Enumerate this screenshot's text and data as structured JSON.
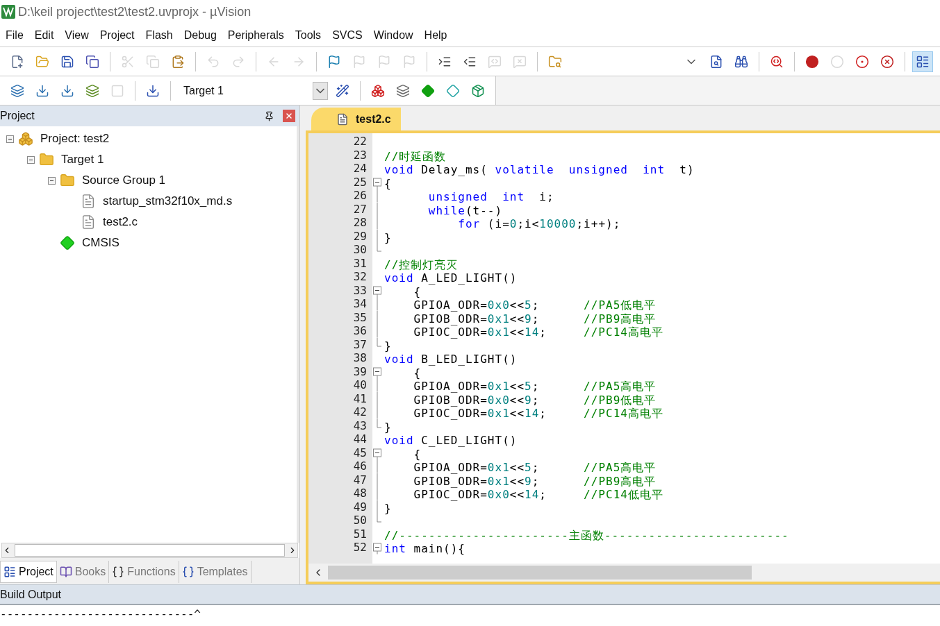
{
  "window": {
    "title": "D:\\keil project\\test2\\test2.uvprojx - µVision"
  },
  "menu": [
    "File",
    "Edit",
    "View",
    "Project",
    "Flash",
    "Debug",
    "Peripherals",
    "Tools",
    "SVCS",
    "Window",
    "Help"
  ],
  "toolbar_1": [
    {
      "disabled": false
    },
    {
      "disabled": false
    },
    {
      "disabled": false
    },
    {
      "disabled": false
    },
    {
      "disabled": true
    },
    {
      "disabled": true
    },
    {
      "disabled": false
    },
    {
      "disabled": true
    },
    {
      "disabled": true
    },
    {
      "disabled": true
    },
    {
      "disabled": true
    },
    {
      "disabled": false
    },
    {
      "disabled": true
    },
    {
      "disabled": true
    },
    {
      "disabled": true
    },
    {
      "disabled": false
    },
    {
      "disabled": false
    },
    {
      "disabled": true
    },
    {
      "disabled": true
    },
    {
      "disabled": false
    },
    {
      "disabled": false
    },
    {
      "disabled": false
    },
    {
      "disabled": false
    },
    {
      "disabled": false
    },
    {
      "disabled": false
    },
    {
      "disabled": true
    },
    {
      "disabled": false
    },
    {
      "disabled": false
    },
    {
      "disabled": false,
      "selected": true
    }
  ],
  "toolbar_2": {
    "buttons": [
      {
        "disabled": false
      },
      {
        "disabled": false
      },
      {
        "disabled": false
      },
      {
        "disabled": false
      },
      {
        "disabled": true
      },
      {
        "disabled": false
      },
      {
        "disabled": false
      },
      {
        "disabled": false
      },
      {
        "disabled": false
      },
      {
        "disabled": false
      },
      {
        "disabled": false
      },
      {
        "disabled": false
      }
    ],
    "target": "Target 1"
  },
  "project_panel": {
    "title": "Project",
    "tree": [
      {
        "label": "Project: test2",
        "kind": "project",
        "expanded": true,
        "children": [
          {
            "label": "Target 1",
            "kind": "target",
            "expanded": true,
            "children": [
              {
                "label": "Source Group 1",
                "kind": "group",
                "expanded": true,
                "children": [
                  {
                    "label": "startup_stm32f10x_md.s",
                    "kind": "file"
                  },
                  {
                    "label": "test2.c",
                    "kind": "file"
                  }
                ]
              },
              {
                "label": "CMSIS",
                "kind": "component"
              }
            ]
          }
        ]
      }
    ],
    "tabs": [
      {
        "label": "Project",
        "selected": true
      },
      {
        "label": "Books",
        "selected": false
      },
      {
        "label": "Functions",
        "selected": false
      },
      {
        "label": "Templates",
        "selected": false
      }
    ]
  },
  "editor": {
    "tabs": [
      {
        "label": "test2.c",
        "selected": true
      }
    ],
    "lines": [
      {
        "n": "22"
      },
      {
        "n": "23",
        "code": [
          {
            "kind": "comment",
            "text": "//时延函数"
          }
        ]
      },
      {
        "n": "24",
        "code": [
          {
            "kind": "keyword",
            "text": "void"
          },
          {
            "kind": "plain",
            "text": " Delay_ms( "
          },
          {
            "kind": "keyword",
            "text": "volatile  unsigned  int"
          },
          {
            "kind": "plain",
            "text": "  t)"
          }
        ]
      },
      {
        "n": "25",
        "kind": "fold-start",
        "code": [
          {
            "kind": "plain",
            "text": "{"
          }
        ]
      },
      {
        "n": "26",
        "kind": "fold-body",
        "code": [
          {
            "kind": "keyword",
            "text": "      unsigned  int"
          },
          {
            "kind": "plain",
            "text": "  i;"
          }
        ]
      },
      {
        "n": "27",
        "kind": "fold-body",
        "code": [
          {
            "kind": "keyword",
            "text": "      while"
          },
          {
            "kind": "plain",
            "text": "(t--)"
          }
        ]
      },
      {
        "n": "28",
        "kind": "fold-body",
        "code": [
          {
            "kind": "keyword",
            "text": "          for"
          },
          {
            "kind": "plain",
            "text": " (i="
          },
          {
            "kind": "number",
            "text": "0"
          },
          {
            "kind": "plain",
            "text": ";i<"
          },
          {
            "kind": "number",
            "text": "10000"
          },
          {
            "kind": "plain",
            "text": ";i++);"
          }
        ]
      },
      {
        "n": "29",
        "kind": "fold-body",
        "code": [
          {
            "kind": "plain",
            "text": "}"
          }
        ]
      },
      {
        "n": "30",
        "kind": "fold-end"
      },
      {
        "n": "31",
        "code": [
          {
            "kind": "comment",
            "text": "//控制灯亮灭"
          }
        ]
      },
      {
        "n": "32",
        "code": [
          {
            "kind": "keyword",
            "text": "void"
          },
          {
            "kind": "plain",
            "text": " A_LED_LIGHT()"
          }
        ]
      },
      {
        "n": "33",
        "kind": "fold-start",
        "code": [
          {
            "kind": "plain",
            "text": "    {"
          }
        ]
      },
      {
        "n": "34",
        "kind": "fold-body",
        "code": [
          {
            "kind": "plain",
            "text": "    GPIOA_ODR="
          },
          {
            "kind": "number",
            "text": "0x0"
          },
          {
            "kind": "plain",
            "text": "<<"
          },
          {
            "kind": "number",
            "text": "5"
          },
          {
            "kind": "plain",
            "text": ";"
          },
          {
            "kind": "comment",
            "text": "      //PA5低电平"
          }
        ]
      },
      {
        "n": "35",
        "kind": "fold-body",
        "code": [
          {
            "kind": "plain",
            "text": "    GPIOB_ODR="
          },
          {
            "kind": "number",
            "text": "0x1"
          },
          {
            "kind": "plain",
            "text": "<<"
          },
          {
            "kind": "number",
            "text": "9"
          },
          {
            "kind": "plain",
            "text": ";"
          },
          {
            "kind": "comment",
            "text": "      //PB9高电平"
          }
        ]
      },
      {
        "n": "36",
        "kind": "fold-body",
        "code": [
          {
            "kind": "plain",
            "text": "    GPIOC_ODR="
          },
          {
            "kind": "number",
            "text": "0x1"
          },
          {
            "kind": "plain",
            "text": "<<"
          },
          {
            "kind": "number",
            "text": "14"
          },
          {
            "kind": "plain",
            "text": ";"
          },
          {
            "kind": "comment",
            "text": "     //PC14高电平"
          }
        ]
      },
      {
        "n": "37",
        "kind": "fold-end",
        "code": [
          {
            "kind": "plain",
            "text": "}"
          }
        ]
      },
      {
        "n": "38",
        "code": [
          {
            "kind": "keyword",
            "text": "void"
          },
          {
            "kind": "plain",
            "text": " B_LED_LIGHT()"
          }
        ]
      },
      {
        "n": "39",
        "kind": "fold-start",
        "code": [
          {
            "kind": "plain",
            "text": "    {"
          }
        ]
      },
      {
        "n": "40",
        "kind": "fold-body",
        "code": [
          {
            "kind": "plain",
            "text": "    GPIOA_ODR="
          },
          {
            "kind": "number",
            "text": "0x1"
          },
          {
            "kind": "plain",
            "text": "<<"
          },
          {
            "kind": "number",
            "text": "5"
          },
          {
            "kind": "plain",
            "text": ";"
          },
          {
            "kind": "comment",
            "text": "      //PA5高电平"
          }
        ]
      },
      {
        "n": "41",
        "kind": "fold-body",
        "code": [
          {
            "kind": "plain",
            "text": "    GPIOB_ODR="
          },
          {
            "kind": "number",
            "text": "0x0"
          },
          {
            "kind": "plain",
            "text": "<<"
          },
          {
            "kind": "number",
            "text": "9"
          },
          {
            "kind": "plain",
            "text": ";"
          },
          {
            "kind": "comment",
            "text": "      //PB9低电平"
          }
        ]
      },
      {
        "n": "42",
        "kind": "fold-body",
        "code": [
          {
            "kind": "plain",
            "text": "    GPIOC_ODR="
          },
          {
            "kind": "number",
            "text": "0x1"
          },
          {
            "kind": "plain",
            "text": "<<"
          },
          {
            "kind": "number",
            "text": "14"
          },
          {
            "kind": "plain",
            "text": ";"
          },
          {
            "kind": "comment",
            "text": "     //PC14高电平"
          }
        ]
      },
      {
        "n": "43",
        "kind": "fold-end",
        "code": [
          {
            "kind": "plain",
            "text": "}"
          }
        ]
      },
      {
        "n": "44",
        "code": [
          {
            "kind": "keyword",
            "text": "void"
          },
          {
            "kind": "plain",
            "text": " C_LED_LIGHT()"
          }
        ]
      },
      {
        "n": "45",
        "kind": "fold-start",
        "code": [
          {
            "kind": "plain",
            "text": "    {"
          }
        ]
      },
      {
        "n": "46",
        "kind": "fold-body",
        "code": [
          {
            "kind": "plain",
            "text": "    GPIOA_ODR="
          },
          {
            "kind": "number",
            "text": "0x1"
          },
          {
            "kind": "plain",
            "text": "<<"
          },
          {
            "kind": "number",
            "text": "5"
          },
          {
            "kind": "plain",
            "text": ";"
          },
          {
            "kind": "comment",
            "text": "      //PA5高电平"
          }
        ]
      },
      {
        "n": "47",
        "kind": "fold-body",
        "code": [
          {
            "kind": "plain",
            "text": "    GPIOB_ODR="
          },
          {
            "kind": "number",
            "text": "0x1"
          },
          {
            "kind": "plain",
            "text": "<<"
          },
          {
            "kind": "number",
            "text": "9"
          },
          {
            "kind": "plain",
            "text": ";"
          },
          {
            "kind": "comment",
            "text": "      //PB9高电平"
          }
        ]
      },
      {
        "n": "48",
        "kind": "fold-body",
        "code": [
          {
            "kind": "plain",
            "text": "    GPIOC_ODR="
          },
          {
            "kind": "number",
            "text": "0x0"
          },
          {
            "kind": "plain",
            "text": "<<"
          },
          {
            "kind": "number",
            "text": "14"
          },
          {
            "kind": "plain",
            "text": ";"
          },
          {
            "kind": "comment",
            "text": "     //PC14低电平"
          }
        ]
      },
      {
        "n": "49",
        "kind": "fold-body",
        "code": [
          {
            "kind": "plain",
            "text": "}"
          }
        ]
      },
      {
        "n": "50",
        "kind": "fold-end"
      },
      {
        "n": "51",
        "code": [
          {
            "kind": "comment",
            "text": "//-----------------------主函数-------------------------"
          }
        ]
      },
      {
        "n": "52",
        "kind": "fold-start",
        "code": [
          {
            "kind": "keyword",
            "text": "int"
          },
          {
            "kind": "plain",
            "text": " main(){"
          }
        ]
      }
    ]
  },
  "build_output": {
    "title": "Build Output",
    "lines": [
      "-----------------------------^"
    ]
  }
}
